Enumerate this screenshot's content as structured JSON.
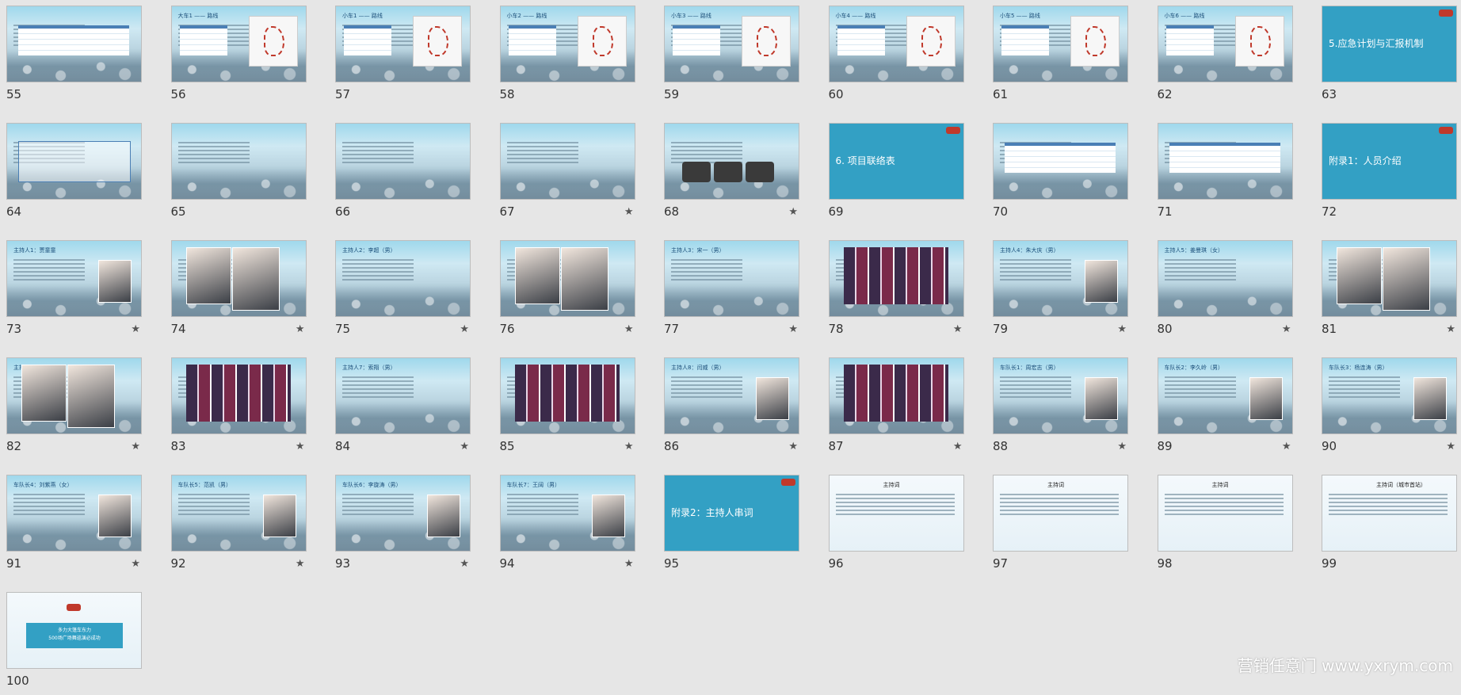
{
  "slides": [
    {
      "number": "55",
      "title": "",
      "starred": false,
      "style": "table"
    },
    {
      "number": "56",
      "title": "大车1 —— 路线",
      "starred": false,
      "style": "map"
    },
    {
      "number": "57",
      "title": "小车1 —— 路线",
      "starred": false,
      "style": "map"
    },
    {
      "number": "58",
      "title": "小车2 —— 路线",
      "starred": false,
      "style": "map"
    },
    {
      "number": "59",
      "title": "小车3 —— 路线",
      "starred": false,
      "style": "map"
    },
    {
      "number": "60",
      "title": "小车4 —— 路线",
      "starred": false,
      "style": "map"
    },
    {
      "number": "61",
      "title": "小车5 —— 路线",
      "starred": false,
      "style": "map"
    },
    {
      "number": "62",
      "title": "小车6 —— 路线",
      "starred": false,
      "style": "map"
    },
    {
      "number": "63",
      "title": "5.应急计划与汇报机制",
      "starred": false,
      "style": "teal"
    },
    {
      "number": "64",
      "title": "",
      "starred": false,
      "style": "flow"
    },
    {
      "number": "65",
      "title": "",
      "starred": false,
      "style": "text"
    },
    {
      "number": "66",
      "title": "",
      "starred": false,
      "style": "text"
    },
    {
      "number": "67",
      "title": "",
      "starred": true,
      "style": "text"
    },
    {
      "number": "68",
      "title": "",
      "starred": true,
      "style": "boxes"
    },
    {
      "number": "69",
      "title": "6. 项目联络表",
      "starred": false,
      "style": "teal"
    },
    {
      "number": "70",
      "title": "",
      "starred": false,
      "style": "table"
    },
    {
      "number": "71",
      "title": "",
      "starred": false,
      "style": "table"
    },
    {
      "number": "72",
      "title": "附录1：人员介绍",
      "starred": false,
      "style": "teal"
    },
    {
      "number": "73",
      "title": "主持人1：贾童童",
      "starred": true,
      "style": "person"
    },
    {
      "number": "74",
      "title": "",
      "starred": true,
      "style": "photos"
    },
    {
      "number": "75",
      "title": "主持人2：李超（男）",
      "starred": true,
      "style": "text"
    },
    {
      "number": "76",
      "title": "",
      "starred": true,
      "style": "photos"
    },
    {
      "number": "77",
      "title": "主持人3：宋一（男）",
      "starred": true,
      "style": "text"
    },
    {
      "number": "78",
      "title": "",
      "starred": true,
      "style": "collage"
    },
    {
      "number": "79",
      "title": "主持人4：朱大庆（男）",
      "starred": true,
      "style": "person"
    },
    {
      "number": "80",
      "title": "主持人5：姜曼琪（女）",
      "starred": true,
      "style": "text"
    },
    {
      "number": "81",
      "title": "",
      "starred": true,
      "style": "photos"
    },
    {
      "number": "82",
      "title": "主持人6：吴亮（男）",
      "starred": true,
      "style": "photos"
    },
    {
      "number": "83",
      "title": "",
      "starred": true,
      "style": "collage"
    },
    {
      "number": "84",
      "title": "主持人7：索翔（男）",
      "starred": true,
      "style": "text"
    },
    {
      "number": "85",
      "title": "",
      "starred": true,
      "style": "collage"
    },
    {
      "number": "86",
      "title": "主持人8：闫威（男）",
      "starred": true,
      "style": "person"
    },
    {
      "number": "87",
      "title": "",
      "starred": true,
      "style": "collage"
    },
    {
      "number": "88",
      "title": "车队长1：周宏志（男）",
      "starred": true,
      "style": "person"
    },
    {
      "number": "89",
      "title": "车队长2：李久岭（男）",
      "starred": true,
      "style": "person"
    },
    {
      "number": "90",
      "title": "车队长3：杨连涛（男）",
      "starred": true,
      "style": "person"
    },
    {
      "number": "91",
      "title": "车队长4：刘紫燕（女）",
      "starred": true,
      "style": "person"
    },
    {
      "number": "92",
      "title": "车队长5：范凯（男）",
      "starred": true,
      "style": "person"
    },
    {
      "number": "93",
      "title": "车队长6：李旋涛（男）",
      "starred": true,
      "style": "person"
    },
    {
      "number": "94",
      "title": "车队长7：王阔（男）",
      "starred": true,
      "style": "person"
    },
    {
      "number": "95",
      "title": "附录2：主持人串词",
      "starred": false,
      "style": "teal"
    },
    {
      "number": "96",
      "title": "主持词",
      "starred": false,
      "style": "white"
    },
    {
      "number": "97",
      "title": "主持词",
      "starred": false,
      "style": "white"
    },
    {
      "number": "98",
      "title": "主持词",
      "starred": false,
      "style": "white"
    },
    {
      "number": "99",
      "title": "主持词（城市首站）",
      "starred": false,
      "style": "white"
    },
    {
      "number": "100",
      "title": "多力大篷车东力\n500场广场舞巡演必成功",
      "starred": false,
      "style": "ending"
    }
  ],
  "star_glyph": "★",
  "watermark": "营销任意门 www.yxrym.com"
}
